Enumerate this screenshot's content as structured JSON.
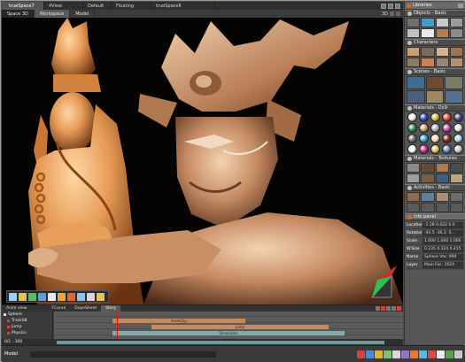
{
  "window": {
    "tabs": [
      "trueSpace7",
      "4View",
      "Default",
      "Floating",
      "trueSpace6"
    ]
  },
  "viewport_header": {
    "tabs": [
      "Space 3D",
      "Workspace",
      "Model"
    ],
    "scale_label": "3D"
  },
  "right_panel": {
    "title": "Libraries",
    "sections": [
      {
        "title": "Objects - Basic"
      },
      {
        "title": "Characters"
      },
      {
        "title": "Scenes - Basic"
      },
      {
        "title": "Materials - Dx9"
      },
      {
        "title": "Materials - Textures"
      },
      {
        "title": "Activities - Basic"
      }
    ],
    "info_panel": {
      "title": "Info panel",
      "rows": [
        {
          "key": "Location",
          "value": "-1.28 0.422 0.0"
        },
        {
          "key": "Rotation",
          "value": "-93.5 -36.3 -5..."
        },
        {
          "key": "Scale",
          "value": "1.000 1.000 1.000"
        },
        {
          "key": "W.Size",
          "value": "0.235 0.324 0.415"
        },
        {
          "key": "Name",
          "value": "Sphere Vtx: 994"
        },
        {
          "key": "Layer",
          "value": "Main Fac: 1024"
        }
      ]
    },
    "colors": {
      "materials": [
        "#f2f2f2",
        "#3d4cc8",
        "#d9c23a",
        "#e14a2f",
        "#5a3e8f",
        "#2e9a49",
        "#cfa46e",
        "#b7b7b7",
        "#c84bb2",
        "#e0e0e0",
        "#6f6f6f",
        "#3fa3d6",
        "#efe2a0",
        "#8c2b1f",
        "#a6d6ef",
        "#ffffff",
        "#cc3399",
        "#e8c65a",
        "#6a88c6",
        "#c7c7c7"
      ]
    }
  },
  "timeline": {
    "tabs": [
      "Anim view",
      "FCurve",
      "DopeSheet",
      "Story"
    ],
    "tracks": [
      "Sphere",
      "Track08",
      "Jump",
      "Physics"
    ],
    "clips": [
      {
        "label": "AnimClip",
        "lane": 1
      },
      {
        "label": "Jump",
        "lane": 2
      },
      {
        "label": "Simulation",
        "lane": 3
      }
    ],
    "frame_value": "0/1 : 300"
  },
  "status_bar": {
    "mode": "Model"
  },
  "icons": {
    "toolbar": [
      "select-icon",
      "move-icon",
      "rotate-icon",
      "scale-icon",
      "render-icon",
      "light-icon",
      "camera-icon",
      "anim-icon",
      "physics-icon",
      "paint-icon"
    ],
    "status": [
      "undo-icon",
      "redo-icon",
      "grid-icon",
      "snap-icon",
      "axis-icon",
      "object-icon",
      "lamp-icon",
      "camera-icon",
      "render-icon",
      "sphere-icon",
      "cube-icon",
      "help-icon"
    ]
  }
}
